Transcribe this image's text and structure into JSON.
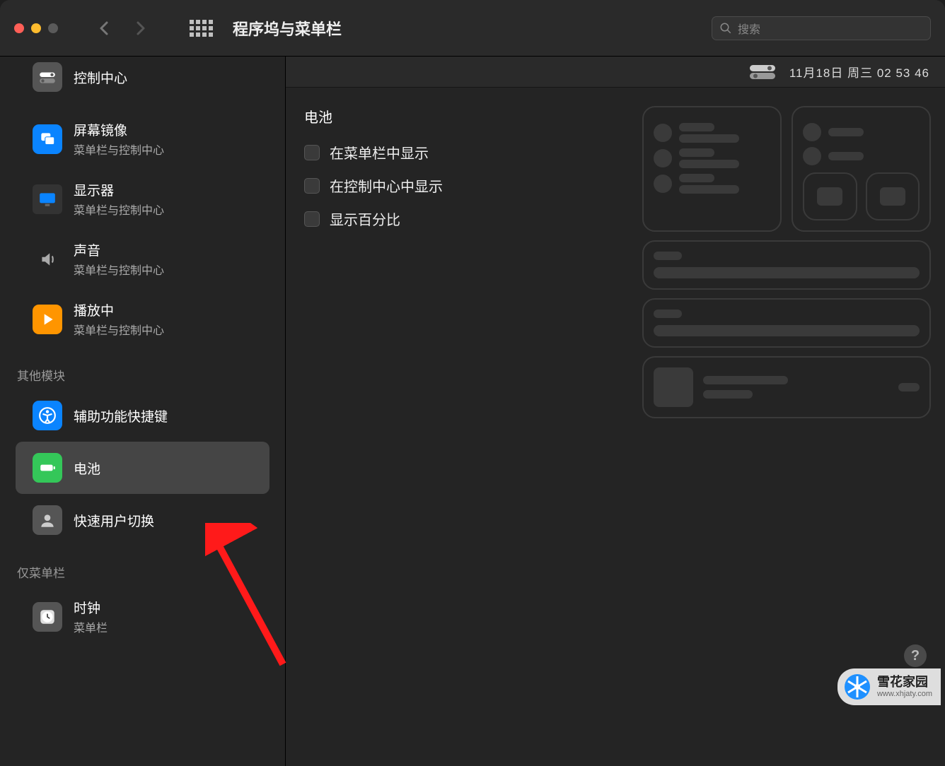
{
  "toolbar": {
    "title": "程序坞与菜单栏",
    "search_placeholder": "搜索"
  },
  "statusbar": {
    "date": "11月18日 周三  02 53 46"
  },
  "sidebar": {
    "control_center": {
      "title": "控制中心"
    },
    "mirror": {
      "title": "屏幕镜像",
      "sub": "菜单栏与控制中心"
    },
    "display": {
      "title": "显示器",
      "sub": "菜单栏与控制中心"
    },
    "sound": {
      "title": "声音",
      "sub": "菜单栏与控制中心"
    },
    "nowplaying": {
      "title": "播放中",
      "sub": "菜单栏与控制中心"
    },
    "section_other": "其他模块",
    "accessibility": {
      "title": "辅助功能快捷键"
    },
    "battery": {
      "title": "电池"
    },
    "userswitch": {
      "title": "快速用户切换"
    },
    "section_menubar_only": "仅菜单栏",
    "clock": {
      "title": "时钟",
      "sub": "菜单栏"
    }
  },
  "main": {
    "section": "电池",
    "opt1": "在菜单栏中显示",
    "opt2": "在控制中心中显示",
    "opt3": "显示百分比"
  },
  "watermark": {
    "name": "雪花家园",
    "url": "www.xhjaty.com"
  }
}
